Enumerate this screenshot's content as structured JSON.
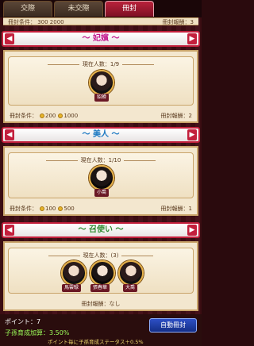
{
  "tabs": [
    {
      "label": "交際"
    },
    {
      "label": "未交際"
    },
    {
      "label": "冊封"
    }
  ],
  "top_partial": {
    "left": "冊封条件： 300  2000",
    "right": "冊封報酬：3"
  },
  "sections": [
    {
      "rank_label": "〜 妃嬪 〜",
      "rank_color": "#c2188f",
      "count": "現在人数：1/9",
      "characters": [
        {
          "name": "貂蝉"
        }
      ],
      "condition_label": "冊封条件：",
      "cond_a": "200",
      "cond_b": "1000",
      "reward": "冊封報酬：2"
    },
    {
      "rank_label": "〜 美人 〜",
      "rank_color": "#1a78c2",
      "count": "現在人数：1/10",
      "characters": [
        {
          "name": "小喬"
        }
      ],
      "condition_label": "冊封条件：",
      "cond_a": "100",
      "cond_b": "500",
      "reward": "冊封報酬：1"
    },
    {
      "rank_label": "〜 召使い 〜",
      "rank_color": "#2e8a2e",
      "count": "現在人数：(3)",
      "characters": [
        {
          "name": "馬雲騄"
        },
        {
          "name": "張春華"
        },
        {
          "name": "大喬"
        }
      ],
      "reward": "冊封報酬：なし"
    }
  ],
  "footer": {
    "points": "ポイント：7",
    "bonus": "子孫育成加算：3.50%",
    "note": "ポイント毎に子孫育成ステータス＋0.5%",
    "auto_button": "自動冊封"
  }
}
